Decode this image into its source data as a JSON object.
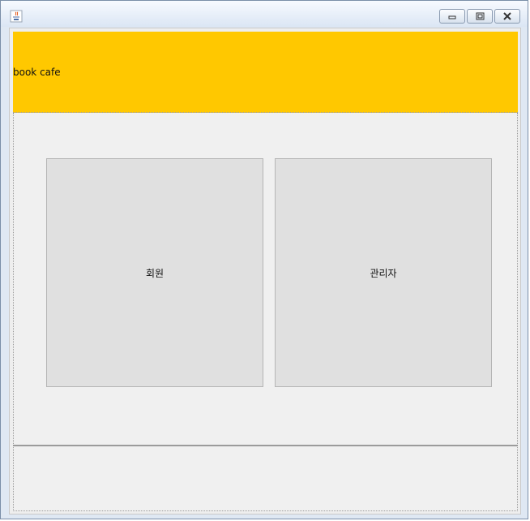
{
  "window": {
    "icon": "java-cup-icon",
    "controls": [
      "minimize-icon",
      "maximize-icon",
      "close-icon"
    ]
  },
  "header": {
    "title": "book cafe",
    "background": "#ffc800"
  },
  "main": {
    "member_button_label": "회원",
    "admin_button_label": "관리자"
  },
  "footer": {}
}
